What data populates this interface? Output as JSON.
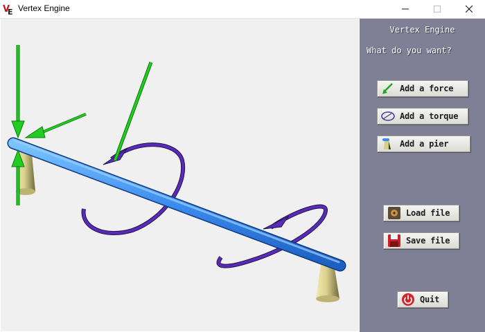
{
  "window": {
    "title": "Vertex Engine",
    "controls": [
      "minimize",
      "maximize",
      "close"
    ]
  },
  "panel": {
    "title": "Vertex Engine",
    "prompt": "What do you want?",
    "buttons": [
      {
        "label": "Add a force",
        "icon": "green-arrow-icon"
      },
      {
        "label": "Add a torque",
        "icon": "torque-icon"
      },
      {
        "label": "Add a pier",
        "icon": "pier-icon"
      },
      {
        "label": "Load file",
        "icon": "disk-icon"
      },
      {
        "label": "Save file",
        "icon": "floppy-icon"
      },
      {
        "label": "Quit",
        "icon": "power-icon"
      }
    ]
  },
  "colors": {
    "panel_bg": "#7f7f95",
    "viewport_bg": "#f0f0f0",
    "beam": "#3c8cf0",
    "force": "#22cc22",
    "torque": "#5a2ab8",
    "pier": "#d8d08a"
  }
}
